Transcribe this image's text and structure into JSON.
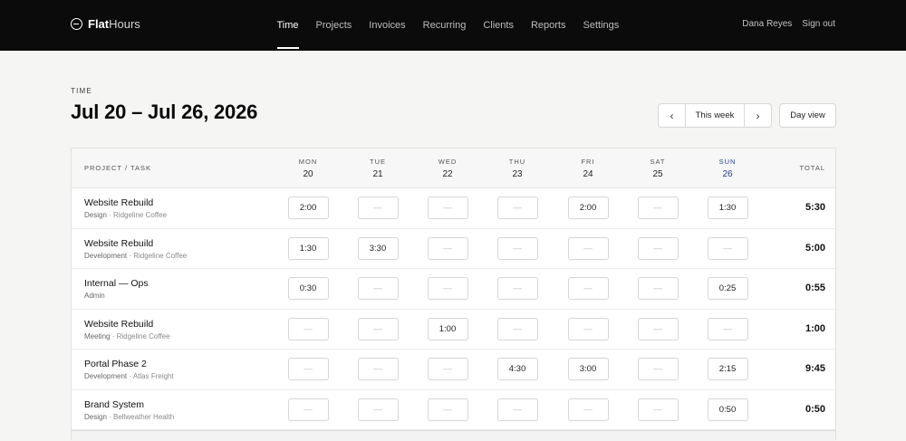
{
  "app": {
    "name_bold": "Flat",
    "name_light": "Hours"
  },
  "nav": [
    {
      "label": "Time",
      "active": true
    },
    {
      "label": "Projects"
    },
    {
      "label": "Invoices"
    },
    {
      "label": "Recurring"
    },
    {
      "label": "Clients"
    },
    {
      "label": "Reports"
    },
    {
      "label": "Settings"
    }
  ],
  "user": {
    "name": "Dana Reyes",
    "sign_out": "Sign out"
  },
  "page": {
    "eyebrow": "TIME",
    "title": "Jul 20 – Jul 26, 2026"
  },
  "controls": {
    "prev": "‹",
    "this_week": "This week",
    "next": "›",
    "day_view": "Day view"
  },
  "table": {
    "project_header": "PROJECT / TASK",
    "total_header": "TOTAL",
    "days": [
      {
        "name": "MON",
        "num": "20"
      },
      {
        "name": "TUE",
        "num": "21"
      },
      {
        "name": "WED",
        "num": "22"
      },
      {
        "name": "THU",
        "num": "23"
      },
      {
        "name": "FRI",
        "num": "24"
      },
      {
        "name": "SAT",
        "num": "25"
      },
      {
        "name": "SUN",
        "num": "26",
        "today": true
      }
    ],
    "rows": [
      {
        "project": "Website Rebuild",
        "task": "Design",
        "client": "Ridgeline Coffee",
        "hours": [
          "2:00",
          "—",
          "—",
          "—",
          "2:00",
          "—",
          "1:30"
        ],
        "total": "5:30"
      },
      {
        "project": "Website Rebuild",
        "task": "Development",
        "client": "Ridgeline Coffee",
        "hours": [
          "1:30",
          "3:30",
          "—",
          "—",
          "—",
          "—",
          "—"
        ],
        "total": "5:00"
      },
      {
        "project": "Internal — Ops",
        "task": "Admin",
        "client": "",
        "hours": [
          "0:30",
          "—",
          "—",
          "—",
          "—",
          "—",
          "0:25"
        ],
        "total": "0:55"
      },
      {
        "project": "Website Rebuild",
        "task": "Meeting",
        "client": "Ridgeline Coffee",
        "hours": [
          "—",
          "—",
          "1:00",
          "—",
          "—",
          "—",
          "—"
        ],
        "total": "1:00"
      },
      {
        "project": "Portal Phase 2",
        "task": "Development",
        "client": "Atlas Freight",
        "hours": [
          "—",
          "—",
          "—",
          "4:30",
          "3:00",
          "—",
          "2:15"
        ],
        "total": "9:45"
      },
      {
        "project": "Brand System",
        "task": "Design",
        "client": "Bellweather Health",
        "hours": [
          "—",
          "—",
          "—",
          "—",
          "—",
          "—",
          "0:50"
        ],
        "total": "0:50"
      }
    ]
  },
  "colors": {
    "topbar": "#0b0b0b",
    "today_accent": "#1f3d8a"
  }
}
